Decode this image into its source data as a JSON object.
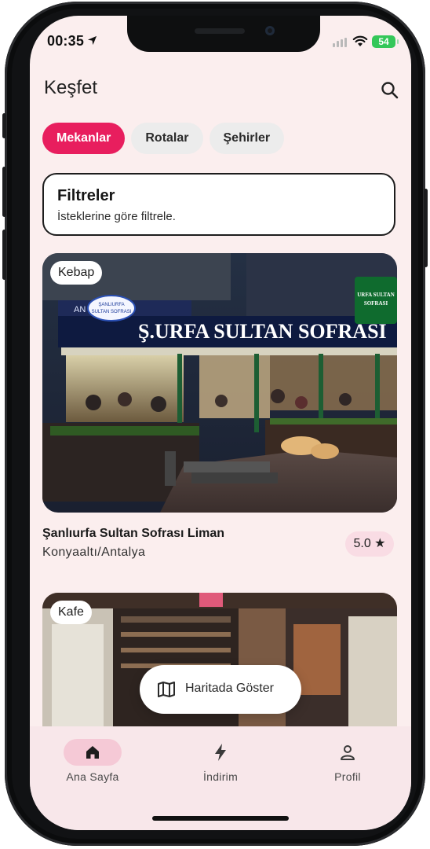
{
  "status": {
    "time": "00:35",
    "battery": "54"
  },
  "header": {
    "title": "Keşfet"
  },
  "tabs": [
    {
      "label": "Mekanlar",
      "active": true
    },
    {
      "label": "Rotalar",
      "active": false
    },
    {
      "label": "Şehirler",
      "active": false
    }
  ],
  "filter": {
    "title": "Filtreler",
    "subtitle": "İsteklerine göre filtrele."
  },
  "places": [
    {
      "category": "Kebap",
      "sign_text": "Ş.URFA SULTAN SOFRASI",
      "sign_logo_line1": "ŞANLIURFA",
      "sign_logo_line2": "SULTAN SOFRASI",
      "neighbor_sign": "AN KUAFÖRÜ",
      "side_sign_line1": "URFA SULTAN",
      "side_sign_line2": "SOFRASI",
      "name": "Şanlıurfa Sultan Sofrası Liman",
      "location": "Konyaaltı/Antalya",
      "rating": "5.0 ★"
    },
    {
      "category": "Kafe"
    }
  ],
  "map_button": {
    "label": "Haritada Göster"
  },
  "bottom_nav": [
    {
      "label": "Ana Sayfa",
      "icon": "home-icon",
      "active": true
    },
    {
      "label": "İndirim",
      "icon": "bolt-icon",
      "active": false
    },
    {
      "label": "Profil",
      "icon": "person-icon",
      "active": false
    }
  ],
  "colors": {
    "accent": "#e81e5e",
    "screen_bg": "#fbeeee",
    "nav_bg": "#f8e7ea",
    "nav_active_pill": "#f5c9d6",
    "rating_bg": "#f9dce4"
  }
}
